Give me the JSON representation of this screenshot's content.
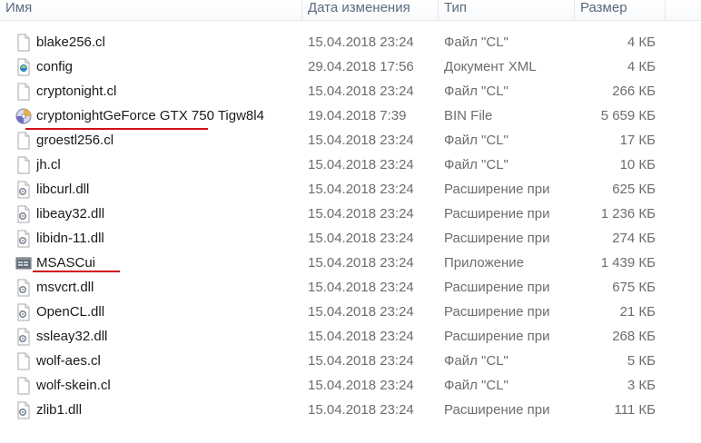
{
  "columns": {
    "name": "Имя",
    "date": "Дата изменения",
    "type": "Тип",
    "size": "Размер"
  },
  "files": [
    {
      "name": "blake256.cl",
      "date": "15.04.2018 23:24",
      "type": "Файл \"CL\"",
      "size": "4 КБ",
      "icon": "file-icon"
    },
    {
      "name": "config",
      "date": "29.04.2018 17:56",
      "type": "Документ XML",
      "size": "4 КБ",
      "icon": "xml-document-icon"
    },
    {
      "name": "cryptonight.cl",
      "date": "15.04.2018 23:24",
      "type": "Файл \"CL\"",
      "size": "266 КБ",
      "icon": "file-icon"
    },
    {
      "name": "cryptonightGeForce GTX 750 Tigw8l4",
      "date": "19.04.2018 7:39",
      "type": "BIN File",
      "size": "5 659 КБ",
      "icon": "disc-image-icon"
    },
    {
      "name": "groestl256.cl",
      "date": "15.04.2018 23:24",
      "type": "Файл \"CL\"",
      "size": "17 КБ",
      "icon": "file-icon"
    },
    {
      "name": "jh.cl",
      "date": "15.04.2018 23:24",
      "type": "Файл \"CL\"",
      "size": "10 КБ",
      "icon": "file-icon"
    },
    {
      "name": "libcurl.dll",
      "date": "15.04.2018 23:24",
      "type": "Расширение при",
      "size": "625 КБ",
      "icon": "dll-icon"
    },
    {
      "name": "libeay32.dll",
      "date": "15.04.2018 23:24",
      "type": "Расширение при",
      "size": "1 236 КБ",
      "icon": "dll-icon"
    },
    {
      "name": "libidn-11.dll",
      "date": "15.04.2018 23:24",
      "type": "Расширение при",
      "size": "274 КБ",
      "icon": "dll-icon"
    },
    {
      "name": "MSASCui",
      "date": "15.04.2018 23:24",
      "type": "Приложение",
      "size": "1 439 КБ",
      "icon": "application-icon"
    },
    {
      "name": "msvcrt.dll",
      "date": "15.04.2018 23:24",
      "type": "Расширение при",
      "size": "675 КБ",
      "icon": "dll-icon"
    },
    {
      "name": "OpenCL.dll",
      "date": "15.04.2018 23:24",
      "type": "Расширение при",
      "size": "21 КБ",
      "icon": "dll-icon"
    },
    {
      "name": "ssleay32.dll",
      "date": "15.04.2018 23:24",
      "type": "Расширение при",
      "size": "268 КБ",
      "icon": "dll-icon"
    },
    {
      "name": "wolf-aes.cl",
      "date": "15.04.2018 23:24",
      "type": "Файл \"CL\"",
      "size": "5 КБ",
      "icon": "file-icon"
    },
    {
      "name": "wolf-skein.cl",
      "date": "15.04.2018 23:24",
      "type": "Файл \"CL\"",
      "size": "3 КБ",
      "icon": "file-icon"
    },
    {
      "name": "zlib1.dll",
      "date": "15.04.2018 23:24",
      "type": "Расширение при",
      "size": "111 КБ",
      "icon": "dll-icon"
    }
  ],
  "annotations": {
    "highlight_color": "#d0121b",
    "underlined_files": [
      "cryptonightGeForce GTX 750 Tigw8l4",
      "MSASCui"
    ]
  }
}
